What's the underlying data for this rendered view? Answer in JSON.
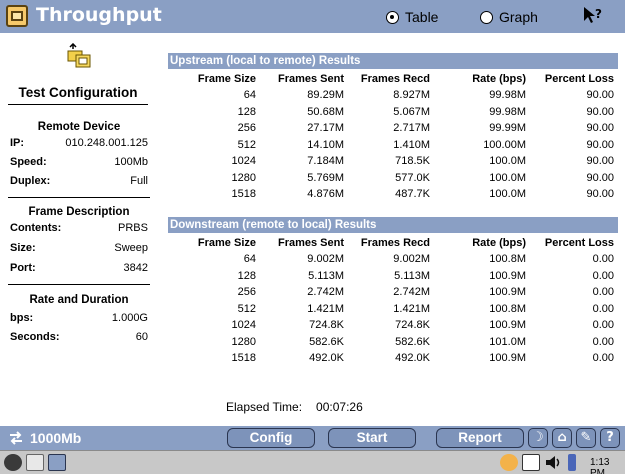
{
  "header": {
    "title": "Throughput",
    "view_options": [
      {
        "label": "Table",
        "selected": true
      },
      {
        "label": "Graph",
        "selected": false
      }
    ],
    "help_icon": "whats-this-icon"
  },
  "left_panel": {
    "heading": "Test Configuration",
    "remote_device": {
      "title": "Remote Device",
      "ip_label": "IP:",
      "ip_value": "010.248.001.125",
      "speed_label": "Speed:",
      "speed_value": "100Mb",
      "duplex_label": "Duplex:",
      "duplex_value": "Full"
    },
    "frame_description": {
      "title": "Frame Description",
      "contents_label": "Contents:",
      "contents_value": "PRBS",
      "size_label": "Size:",
      "size_value": "Sweep",
      "port_label": "Port:",
      "port_value": "3842"
    },
    "rate_duration": {
      "title": "Rate and Duration",
      "bps_label": "bps:",
      "bps_value": "1.000G",
      "seconds_label": "Seconds:",
      "seconds_value": "60"
    }
  },
  "upstream": {
    "title": "Upstream (local to remote) Results",
    "columns": [
      "Frame Size",
      "Frames Sent",
      "Frames Recd",
      "Rate (bps)",
      "Percent Loss"
    ],
    "rows": [
      [
        "64",
        "89.29M",
        "8.927M",
        "99.98M",
        "90.00"
      ],
      [
        "128",
        "50.68M",
        "5.067M",
        "99.98M",
        "90.00"
      ],
      [
        "256",
        "27.17M",
        "2.717M",
        "99.99M",
        "90.00"
      ],
      [
        "512",
        "14.10M",
        "1.410M",
        "100.00M",
        "90.00"
      ],
      [
        "1024",
        "7.184M",
        "718.5K",
        "100.0M",
        "90.00"
      ],
      [
        "1280",
        "5.769M",
        "577.0K",
        "100.0M",
        "90.00"
      ],
      [
        "1518",
        "4.876M",
        "487.7K",
        "100.0M",
        "90.00"
      ]
    ]
  },
  "downstream": {
    "title": "Downstream (remote to local) Results",
    "columns": [
      "Frame Size",
      "Frames Sent",
      "Frames Recd",
      "Rate (bps)",
      "Percent Loss"
    ],
    "rows": [
      [
        "64",
        "9.002M",
        "9.002M",
        "100.8M",
        "0.00"
      ],
      [
        "128",
        "5.113M",
        "5.113M",
        "100.9M",
        "0.00"
      ],
      [
        "256",
        "2.742M",
        "2.742M",
        "100.9M",
        "0.00"
      ],
      [
        "512",
        "1.421M",
        "1.421M",
        "100.8M",
        "0.00"
      ],
      [
        "1024",
        "724.8K",
        "724.8K",
        "100.9M",
        "0.00"
      ],
      [
        "1280",
        "582.6K",
        "582.6K",
        "101.0M",
        "0.00"
      ],
      [
        "1518",
        "492.0K",
        "492.0K",
        "100.9M",
        "0.00"
      ]
    ]
  },
  "elapsed": {
    "label": "Elapsed Time:",
    "value": "00:07:26"
  },
  "toolbar": {
    "speed_label": "1000Mb",
    "config_label": "Config",
    "start_label": "Start",
    "report_label": "Report",
    "help_label": "?"
  },
  "taskbar": {
    "clock": "1:13 PM"
  },
  "colors": {
    "accent": "#8a9fc4",
    "background": "#ffffff",
    "taskbar": "#c8c8c8"
  }
}
